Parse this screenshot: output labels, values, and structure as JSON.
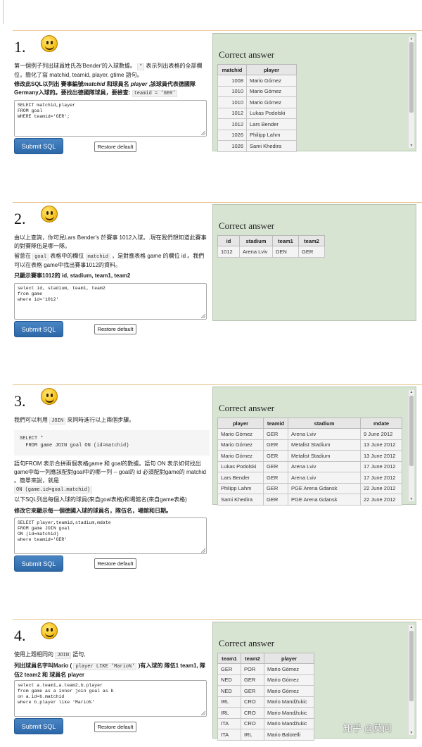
{
  "answer_title": "Correct answer",
  "submit_label": "Submit SQL",
  "restore_label": "Restore default",
  "watermark": "知乎 @莫问",
  "q1": {
    "num": "1.",
    "p1a": "第一個例子列出球員姓氏為'Bender'的入球數據。",
    "p1code": "*",
    "p1b": "表示列出表格的全部欄位，簡化了寫 matchid, teamid, player, gtime 語句。",
    "p2a": "修改此SQL以列出 賽事編號",
    "p2em1": "matchid",
    "p2b": " 和球員名 ",
    "p2em2": "player",
    "p2c": " ,該球員代表德國隊Germany入球的。要找出德國隊球員，要檢查:",
    "p2code": "teamid = 'GER'",
    "sql": "SELECT matchid,player\nFROM goal\nWHERE teamid='GER';",
    "table": {
      "headers": [
        "matchid",
        "player"
      ],
      "rows": [
        [
          "1008",
          "Mario Gómez"
        ],
        [
          "1010",
          "Mario Gómez"
        ],
        [
          "1010",
          "Mario Gómez"
        ],
        [
          "1012",
          "Lukas Podolski"
        ],
        [
          "1012",
          "Lars Bender"
        ],
        [
          "1026",
          "Philipp Lahm"
        ],
        [
          "1026",
          "Sami Khedira"
        ]
      ]
    }
  },
  "q2": {
    "num": "2.",
    "p1": "由以上查詢，你可見Lars Bender's 於賽事 1012入球。.現在我們想知道此賽事的對賽隊伍是哪一隊。",
    "p2a": "留意在",
    "p2code1": "goal",
    "p2b": "表格中的欄位",
    "p2code2": "matchid",
    "p2c": "，是對應表格 game 的欄位 id 。我們可以在表格 game中找出賽事1012的資料。",
    "p3": "只顯示賽事1012的 id, stadium, team1, team2",
    "sql": "select id, stadium, team1, team2\nfrom game\nwhere id='1012'",
    "table": {
      "headers": [
        "id",
        "stadium",
        "team1",
        "team2"
      ],
      "rows": [
        [
          "1012",
          "Arena Lviv",
          "DEN",
          "GER"
        ]
      ]
    }
  },
  "q3": {
    "num": "3.",
    "p1a": "我們可以利用",
    "p1code": "JOIN",
    "p1b": "來同時進行以上兩個步驟。",
    "pre": "SELECT *\n  FROM game JOIN goal ON (id=matchid)",
    "p2": "語句FROM 表示合拼兩個表格game 和 goal的數據。語句 ON 表示如何找出game中每一列應該配對goal中的哪一列 -- goal的 id 必須配對game的 matchid 。簡單來說，就是",
    "p2code": "ON (game.id=goal.matchid)",
    "p3": "以下SQL列出每個入球的球員(來自goal表格)和場館名(來自game表格)",
    "p4": "修改它來顯示每一個德國入球的球員名，隊伍名，場館和日期。",
    "sql": "SELECT player,teamid,stadium,mdate\nFROM game JOIN goal\nON (id=matchid)\nwhere teamid='GER'",
    "table": {
      "headers": [
        "player",
        "teamid",
        "stadium",
        "mdate"
      ],
      "rows": [
        [
          "Mario Gómez",
          "GER",
          "Arena Lviv",
          "9 June 2012"
        ],
        [
          "Mario Gómez",
          "GER",
          "Metalist Stadium",
          "13 June 2012"
        ],
        [
          "Mario Gómez",
          "GER",
          "Metalist Stadium",
          "13 June 2012"
        ],
        [
          "Lukas Podolski",
          "GER",
          "Arena Lviv",
          "17 June 2012"
        ],
        [
          "Lars Bender",
          "GER",
          "Arena Lviv",
          "17 June 2012"
        ],
        [
          "Philipp Lahm",
          "GER",
          "PGE Arena Gdansk",
          "22 June 2012"
        ],
        [
          "Sami Khedira",
          "GER",
          "PGE Arena Gdansk",
          "22 June 2012"
        ]
      ]
    }
  },
  "q4": {
    "num": "4.",
    "p1a": "使用上題相同的",
    "p1code": "JOIN",
    "p1b": "語句,",
    "p2a": "列出球員名字叫Mario (",
    "p2code": "player LIKE 'Mario%'",
    "p2b": ")有入球的 隊伍1 team1, 隊伍2 team2 和 球員名 player",
    "sql": "select a.team1,a.team2,b.player\nfrom game as a inner join goal as b\non a.id=b.matchid\nwhere b.player like 'Mario%'",
    "table": {
      "headers": [
        "team1",
        "team2",
        "player"
      ],
      "rows": [
        [
          "GER",
          "POR",
          "Mario Gómez"
        ],
        [
          "NED",
          "GER",
          "Mario Gómez"
        ],
        [
          "NED",
          "GER",
          "Mario Gómez"
        ],
        [
          "IRL",
          "CRO",
          "Mario Mandžukic"
        ],
        [
          "IRL",
          "CRO",
          "Mario Mandžukic"
        ],
        [
          "ITA",
          "CRO",
          "Mario Mandžukic"
        ],
        [
          "ITA",
          "IRL",
          "Mario Balotelli"
        ]
      ]
    }
  }
}
